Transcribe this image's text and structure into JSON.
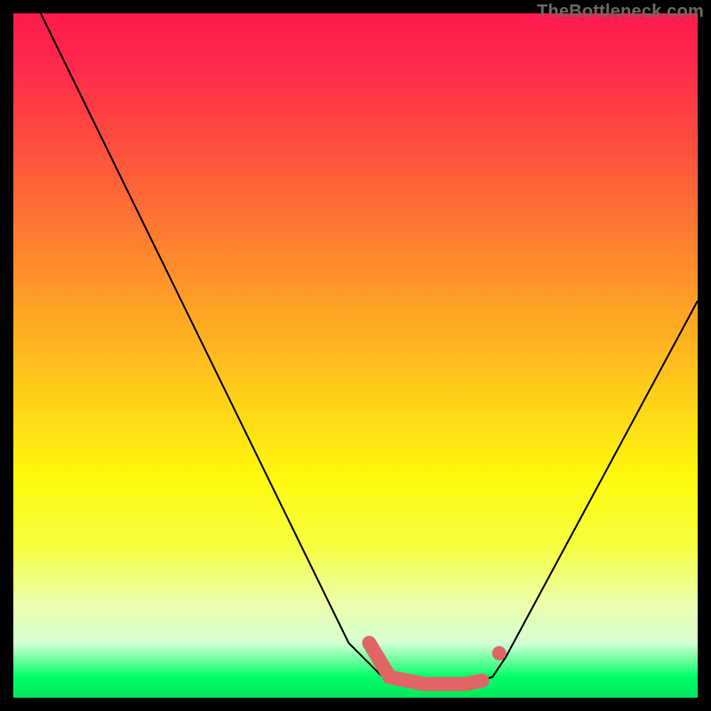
{
  "watermark": "TheBottleneck.com",
  "chart_data": {
    "type": "line",
    "title": "",
    "xlabel": "",
    "ylabel": "",
    "xlim": [
      0,
      100
    ],
    "ylim": [
      0,
      100
    ],
    "grid": false,
    "curve": {
      "left_branch": [
        {
          "x": 4,
          "y": 100
        },
        {
          "x": 49,
          "y": 8
        },
        {
          "x": 54,
          "y": 3
        }
      ],
      "valley": [
        {
          "x": 54,
          "y": 3
        },
        {
          "x": 60,
          "y": 2
        },
        {
          "x": 66,
          "y": 2
        },
        {
          "x": 70,
          "y": 3
        }
      ],
      "right_branch": [
        {
          "x": 70,
          "y": 3
        },
        {
          "x": 72,
          "y": 6
        },
        {
          "x": 100,
          "y": 58
        }
      ]
    },
    "highlight_segment": {
      "color": "#e06666",
      "points": [
        {
          "x": 52,
          "y": 8
        },
        {
          "x": 55,
          "y": 3
        },
        {
          "x": 60,
          "y": 2
        },
        {
          "x": 66,
          "y": 2
        },
        {
          "x": 68.5,
          "y": 2.5
        }
      ],
      "extra_dot": {
        "x": 71,
        "y": 6.5
      }
    },
    "background_gradient": {
      "top": "#ff1a4d",
      "mid": "#ffd617",
      "bottom": "#00ff66"
    }
  }
}
